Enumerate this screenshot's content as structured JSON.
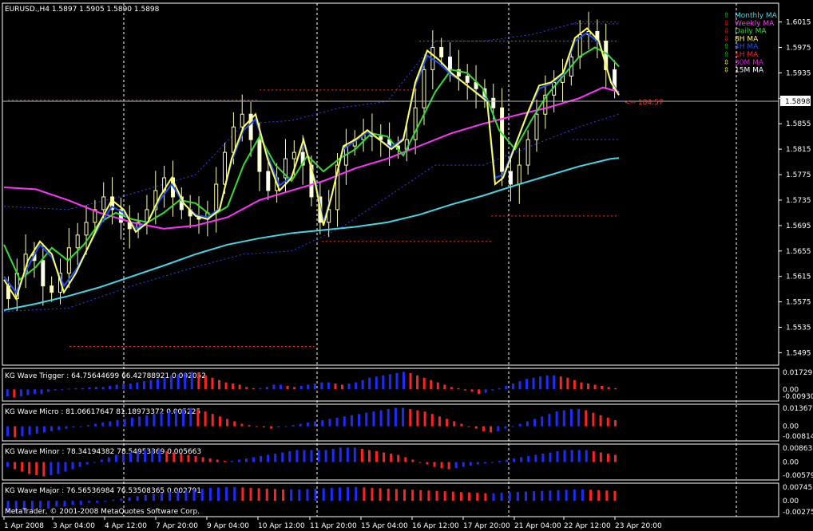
{
  "symbol_header": "EURUSD.,H4  1.5897  1.5905  1.5890  1.5898",
  "current_price": "1.5898",
  "countdown": "<-- 184:57",
  "copyright": "MetaTrader, © 2001-2008 MetaQuotes Software Corp.",
  "legend": [
    {
      "label": "Monthly MA",
      "color": "#44d6e8",
      "arrow": "⇧",
      "arrow_color": "#22cc22"
    },
    {
      "label": "Weekly MA",
      "color": "#ff33ff",
      "arrow": "⇩",
      "arrow_color": "#ff2222"
    },
    {
      "label": "Daily MA",
      "color": "#33dd33",
      "arrow": "⇩",
      "arrow_color": "#ff2222"
    },
    {
      "label": "8H MA",
      "color": "#ffff55",
      "arrow": "⇩",
      "arrow_color": "#ff2222"
    },
    {
      "label": "4H MA",
      "color": "#1e4fff",
      "arrow": "⇧",
      "arrow_color": "#22cc22"
    },
    {
      "label": "1H MA",
      "color": "#ff2222",
      "arrow": "⇧",
      "arrow_color": "#22cc22"
    },
    {
      "label": "30M MA",
      "color": "#cc22cc",
      "arrow": "⇳",
      "arrow_color": "#ffff55"
    },
    {
      "label": "15M MA",
      "color": "#ffffff",
      "arrow": "⇳",
      "arrow_color": "#ffff55"
    }
  ],
  "price_axis": {
    "ticks": [
      "1.6015",
      "1.5975",
      "1.5935",
      "1.5895",
      "1.5855",
      "1.5815",
      "1.5775",
      "1.5735",
      "1.5695",
      "1.5655",
      "1.5615",
      "1.5575",
      "1.5535",
      "1.5495"
    ],
    "ylim": [
      1.5478,
      1.6042
    ]
  },
  "time_axis": [
    "1 Apr 2008",
    "3 Apr 04:00",
    "4 Apr 12:00",
    "7 Apr 20:00",
    "9 Apr 04:00",
    "10 Apr 12:00",
    "11 Apr 20:00",
    "15 Apr 04:00",
    "16 Apr 12:00",
    "17 Apr 20:00",
    "21 Apr 04:00",
    "22 Apr 12:00",
    "23 Apr 20:00"
  ],
  "chart_data": {
    "type": "candlestick",
    "ma_monthly": [
      [
        0,
        1.5562
      ],
      [
        40,
        1.5572
      ],
      [
        80,
        1.5584
      ],
      [
        120,
        1.5598
      ],
      [
        160,
        1.5615
      ],
      [
        200,
        1.5632
      ],
      [
        240,
        1.565
      ],
      [
        280,
        1.5665
      ],
      [
        320,
        1.5675
      ],
      [
        360,
        1.5683
      ],
      [
        400,
        1.5688
      ],
      [
        440,
        1.5693
      ],
      [
        480,
        1.57
      ],
      [
        520,
        1.5712
      ],
      [
        560,
        1.5728
      ],
      [
        600,
        1.5742
      ],
      [
        640,
        1.5758
      ],
      [
        680,
        1.5773
      ],
      [
        720,
        1.5788
      ],
      [
        760,
        1.58
      ],
      [
        770,
        1.5801
      ]
    ],
    "ma_weekly": [
      [
        0,
        1.5755
      ],
      [
        40,
        1.5752
      ],
      [
        80,
        1.5735
      ],
      [
        120,
        1.5715
      ],
      [
        160,
        1.57
      ],
      [
        200,
        1.569
      ],
      [
        240,
        1.5695
      ],
      [
        280,
        1.5708
      ],
      [
        320,
        1.5735
      ],
      [
        360,
        1.575
      ],
      [
        400,
        1.5765
      ],
      [
        440,
        1.5785
      ],
      [
        480,
        1.58
      ],
      [
        520,
        1.582
      ],
      [
        560,
        1.584
      ],
      [
        600,
        1.5855
      ],
      [
        640,
        1.5868
      ],
      [
        680,
        1.588
      ],
      [
        720,
        1.5895
      ],
      [
        750,
        1.5912
      ],
      [
        770,
        1.5905
      ]
    ],
    "ma_daily": [
      [
        0,
        1.5665
      ],
      [
        20,
        1.561
      ],
      [
        40,
        1.563
      ],
      [
        60,
        1.566
      ],
      [
        80,
        1.564
      ],
      [
        100,
        1.5665
      ],
      [
        120,
        1.57
      ],
      [
        140,
        1.5715
      ],
      [
        160,
        1.5705
      ],
      [
        180,
        1.57
      ],
      [
        200,
        1.5715
      ],
      [
        220,
        1.5735
      ],
      [
        240,
        1.573
      ],
      [
        260,
        1.571
      ],
      [
        280,
        1.5725
      ],
      [
        300,
        1.579
      ],
      [
        320,
        1.5835
      ],
      [
        340,
        1.579
      ],
      [
        360,
        1.5765
      ],
      [
        380,
        1.5805
      ],
      [
        400,
        1.578
      ],
      [
        420,
        1.58
      ],
      [
        440,
        1.5815
      ],
      [
        460,
        1.584
      ],
      [
        480,
        1.5835
      ],
      [
        500,
        1.5805
      ],
      [
        520,
        1.5855
      ],
      [
        540,
        1.5905
      ],
      [
        560,
        1.594
      ],
      [
        580,
        1.5935
      ],
      [
        600,
        1.591
      ],
      [
        620,
        1.5845
      ],
      [
        640,
        1.5815
      ],
      [
        660,
        1.586
      ],
      [
        680,
        1.59
      ],
      [
        700,
        1.593
      ],
      [
        720,
        1.596
      ],
      [
        740,
        1.5975
      ],
      [
        755,
        1.5965
      ],
      [
        770,
        1.5945
      ]
    ],
    "ma_8h": [
      [
        0,
        1.561
      ],
      [
        15,
        1.558
      ],
      [
        30,
        1.564
      ],
      [
        45,
        1.567
      ],
      [
        60,
        1.565
      ],
      [
        75,
        1.559
      ],
      [
        90,
        1.562
      ],
      [
        105,
        1.566
      ],
      [
        120,
        1.57
      ],
      [
        135,
        1.5735
      ],
      [
        150,
        1.572
      ],
      [
        165,
        1.5685
      ],
      [
        180,
        1.57
      ],
      [
        195,
        1.574
      ],
      [
        210,
        1.577
      ],
      [
        225,
        1.573
      ],
      [
        240,
        1.571
      ],
      [
        255,
        1.5705
      ],
      [
        270,
        1.572
      ],
      [
        285,
        1.58
      ],
      [
        300,
        1.585
      ],
      [
        315,
        1.587
      ],
      [
        330,
        1.58
      ],
      [
        345,
        1.575
      ],
      [
        360,
        1.577
      ],
      [
        375,
        1.583
      ],
      [
        390,
        1.576
      ],
      [
        400,
        1.5695
      ],
      [
        410,
        1.574
      ],
      [
        425,
        1.582
      ],
      [
        440,
        1.583
      ],
      [
        455,
        1.5845
      ],
      [
        470,
        1.583
      ],
      [
        485,
        1.5815
      ],
      [
        500,
        1.583
      ],
      [
        515,
        1.592
      ],
      [
        530,
        1.597
      ],
      [
        545,
        1.5955
      ],
      [
        560,
        1.5935
      ],
      [
        575,
        1.592
      ],
      [
        590,
        1.5905
      ],
      [
        605,
        1.589
      ],
      [
        615,
        1.576
      ],
      [
        625,
        1.577
      ],
      [
        640,
        1.582
      ],
      [
        655,
        1.587
      ],
      [
        670,
        1.5915
      ],
      [
        685,
        1.592
      ],
      [
        700,
        1.5935
      ],
      [
        715,
        1.599
      ],
      [
        730,
        1.6005
      ],
      [
        745,
        1.5985
      ],
      [
        760,
        1.592
      ],
      [
        770,
        1.59
      ]
    ],
    "ma_4h": [
      [
        0,
        1.5615
      ],
      [
        15,
        1.559
      ],
      [
        30,
        1.563
      ],
      [
        45,
        1.5665
      ],
      [
        60,
        1.5645
      ],
      [
        75,
        1.56
      ],
      [
        90,
        1.5625
      ],
      [
        105,
        1.566
      ],
      [
        120,
        1.5695
      ],
      [
        135,
        1.5725
      ],
      [
        150,
        1.5715
      ],
      [
        165,
        1.569
      ],
      [
        180,
        1.57
      ],
      [
        195,
        1.5735
      ],
      [
        210,
        1.576
      ],
      [
        225,
        1.573
      ],
      [
        240,
        1.5712
      ],
      [
        255,
        1.5708
      ],
      [
        270,
        1.5722
      ],
      [
        285,
        1.5795
      ],
      [
        300,
        1.5845
      ],
      [
        315,
        1.5862
      ],
      [
        330,
        1.5805
      ],
      [
        345,
        1.5758
      ],
      [
        360,
        1.5772
      ],
      [
        375,
        1.5825
      ],
      [
        390,
        1.5765
      ],
      [
        400,
        1.57
      ],
      [
        410,
        1.5742
      ],
      [
        425,
        1.5815
      ],
      [
        440,
        1.5828
      ],
      [
        455,
        1.5842
      ],
      [
        470,
        1.583
      ],
      [
        485,
        1.5818
      ],
      [
        500,
        1.5832
      ],
      [
        515,
        1.5915
      ],
      [
        530,
        1.5962
      ],
      [
        545,
        1.595
      ],
      [
        560,
        1.5932
      ],
      [
        575,
        1.592
      ],
      [
        590,
        1.5906
      ],
      [
        605,
        1.5892
      ],
      [
        615,
        1.577
      ],
      [
        625,
        1.5775
      ],
      [
        640,
        1.5822
      ],
      [
        655,
        1.5868
      ],
      [
        670,
        1.591
      ],
      [
        685,
        1.5918
      ],
      [
        700,
        1.5932
      ],
      [
        715,
        1.5985
      ],
      [
        730,
        1.5998
      ],
      [
        745,
        1.5982
      ],
      [
        760,
        1.5922
      ],
      [
        770,
        1.5902
      ]
    ],
    "bb_upper": [
      [
        0,
        1.5725
      ],
      [
        80,
        1.572
      ],
      [
        160,
        1.5745
      ],
      [
        240,
        1.5775
      ],
      [
        300,
        1.5855
      ],
      [
        360,
        1.586
      ],
      [
        420,
        1.588
      ],
      [
        480,
        1.589
      ],
      [
        540,
        1.5985
      ],
      [
        600,
        1.5985
      ],
      [
        660,
        1.5995
      ],
      [
        720,
        1.6015
      ],
      [
        770,
        1.6015
      ]
    ],
    "bb_lower": [
      [
        0,
        1.556
      ],
      [
        80,
        1.5565
      ],
      [
        160,
        1.56
      ],
      [
        240,
        1.563
      ],
      [
        300,
        1.565
      ],
      [
        360,
        1.5655
      ],
      [
        420,
        1.569
      ],
      [
        480,
        1.574
      ],
      [
        540,
        1.579
      ],
      [
        600,
        1.579
      ],
      [
        660,
        1.582
      ],
      [
        720,
        1.585
      ],
      [
        770,
        1.587
      ]
    ],
    "levels": [
      {
        "price": 1.5892,
        "x0": 5,
        "x1": 320,
        "color": "#ff2222"
      },
      {
        "price": 1.5908,
        "x0": 320,
        "x1": 520,
        "color": "#ff2222"
      },
      {
        "price": 1.5985,
        "x0": 520,
        "x1": 770,
        "color": "#ff2222"
      },
      {
        "price": 1.5505,
        "x0": 82,
        "x1": 388,
        "color": "#ff2222"
      },
      {
        "price": 1.567,
        "x0": 398,
        "x1": 610,
        "color": "#ff2222"
      },
      {
        "price": 1.571,
        "x0": 610,
        "x1": 770,
        "color": "#ff2222"
      },
      {
        "price": 1.6012,
        "x0": 712,
        "x1": 770,
        "color": "#2244ff"
      },
      {
        "price": 1.583,
        "x0": 712,
        "x1": 770,
        "color": "#2244ff"
      }
    ],
    "candle_seed": [
      1.56,
      1.558,
      1.562,
      1.565,
      1.564,
      1.56,
      1.559,
      1.562,
      1.566,
      1.568,
      1.57,
      1.572,
      1.574,
      1.572,
      1.57,
      1.569,
      1.57,
      1.572,
      1.575,
      1.577,
      1.574,
      1.572,
      1.571,
      1.5705,
      1.5715,
      1.576,
      1.581,
      1.585,
      1.587,
      1.583,
      1.578,
      1.575,
      1.577,
      1.58,
      1.581,
      1.579,
      1.574,
      1.57,
      1.572,
      1.579,
      1.582,
      1.583,
      1.584,
      1.5835,
      1.583,
      1.582,
      1.5815,
      1.583,
      1.588,
      1.594,
      1.5975,
      1.596,
      1.594,
      1.593,
      1.592,
      1.591,
      1.5895,
      1.588,
      1.578,
      1.576,
      1.579,
      1.583,
      1.587,
      1.59,
      1.592,
      1.593,
      1.596,
      1.5995,
      1.6,
      1.5985,
      1.594,
      1.591
    ]
  },
  "indicators": [
    {
      "label": "KG Wave Trigger : 64.75644699 66.42788921 0.002052",
      "ticks": [
        "0.017297",
        "0.00",
        "-0.009301"
      ],
      "values": [
        -3,
        -3.5,
        -3,
        -2.5,
        -2,
        -2,
        -1,
        -0.5,
        0,
        0.3,
        0.5,
        0.5,
        0.8,
        1,
        1,
        1.5,
        2,
        2.5,
        2.5,
        3,
        3.5,
        4,
        4.5,
        5,
        6,
        6.5,
        7,
        7.5,
        7,
        6,
        5,
        4,
        3,
        2.5,
        2,
        1,
        0.5,
        0.5,
        1,
        2,
        2,
        1.5,
        1,
        1.5,
        2,
        2.5,
        3,
        3,
        2.5,
        2,
        2.5,
        3,
        4,
        5,
        5.5,
        6,
        6.5,
        7,
        7.5,
        7,
        6,
        5,
        4,
        3,
        2,
        1,
        0.5,
        -0.5,
        -1,
        -2,
        -1.5,
        -0.5,
        0.5,
        1.5,
        2.5,
        3.5,
        4.5,
        5,
        5.5,
        6,
        6,
        5.5,
        5,
        4,
        3,
        2.5,
        2,
        1.5,
        1,
        0.5
      ],
      "vmin": -4,
      "vmax": 8
    },
    {
      "label": "KG Wave Micro : 81.06617647 81.18973372 0.005225",
      "ticks": [
        "0.013679",
        "0.00",
        "-0.008147"
      ],
      "values": [
        -4,
        -4.5,
        -4,
        -3.5,
        -3,
        -2.5,
        -2,
        -1.5,
        -1,
        -0.5,
        0,
        0.5,
        1,
        1.5,
        2,
        2.5,
        3,
        3.5,
        4,
        4.5,
        5,
        5.5,
        6,
        6.5,
        7,
        7.5,
        7,
        6,
        5,
        4,
        3,
        2,
        1,
        0.5,
        0,
        -0.5,
        -1,
        -0.5,
        0,
        0.5,
        1,
        1.5,
        2,
        2.5,
        3,
        3.5,
        4,
        4.5,
        5,
        5.5,
        6,
        6.5,
        7,
        7.5,
        7.5,
        7,
        6.5,
        6,
        5,
        4,
        3,
        2,
        1,
        0,
        -1,
        -2,
        -2.5,
        -2,
        -1,
        0,
        1,
        2,
        3,
        4,
        5,
        6,
        6.5,
        7,
        7,
        6.5,
        5.5,
        4.5,
        3.5,
        2.5
      ],
      "vmin": -5,
      "vmax": 8
    },
    {
      "label": "KG Wave Minor : 78.34194382 78.54953369 0.005663",
      "ticks": [
        "0.008633",
        "0.00",
        "-0.005795"
      ],
      "values": [
        -2,
        -3,
        -4,
        -5,
        -5.5,
        -6,
        -5.5,
        -5,
        -4,
        -3,
        -2,
        -1,
        0,
        1,
        2,
        3,
        3.5,
        4,
        4.5,
        5,
        5,
        5,
        4.5,
        4,
        3.5,
        3,
        2.5,
        2,
        1.5,
        1,
        0.5,
        0.5,
        1,
        1.5,
        2,
        2.5,
        3,
        3.5,
        4,
        4.5,
        5,
        5,
        5,
        5,
        5,
        5.5,
        6,
        6,
        6,
        5.5,
        5,
        4.5,
        4,
        3.5,
        3,
        2,
        1,
        0,
        -1,
        -2,
        -2.5,
        -3,
        -2.5,
        -2,
        -1.5,
        -1,
        -0.5,
        0,
        0.5,
        1,
        1.5,
        2,
        2.5,
        3,
        3.5,
        4,
        4.5,
        5,
        5,
        5,
        5,
        4.5,
        4,
        3.5,
        3
      ],
      "vmin": -6.5,
      "vmax": 6.5
    },
    {
      "label": "KG Wave Major : 76.56536984 76.53508365 0.002791",
      "ticks": [
        "0.007457",
        "0.00",
        "-0.002759"
      ],
      "values": [
        -3,
        -3,
        -2.5,
        -2.5,
        -2,
        -2,
        -1.5,
        -1.5,
        -1,
        -1,
        -0.5,
        -0.5,
        0,
        0.3,
        0.6,
        0.9,
        1.2,
        1.5,
        1.8,
        2.1,
        2.4,
        2.6,
        2.8,
        3,
        3.2,
        3.4,
        3.5,
        3.6,
        3.6,
        3.5,
        3.4,
        3.3,
        3.2,
        3.1,
        3,
        3,
        3,
        3.1,
        3.2,
        3.3,
        3.4,
        3.5,
        3.6,
        3.6,
        3.5,
        3.4,
        3.3,
        3.2,
        3.1,
        3,
        2.9,
        2.8,
        2.7,
        2.6,
        2.5,
        2.4,
        2.3,
        2.2,
        2.1,
        2,
        2,
        2.1,
        2.2,
        2.3,
        2.4,
        2.5,
        2.6,
        2.7,
        2.8,
        2.9,
        3,
        3,
        2.9,
        2.8,
        2.7,
        2.6
      ],
      "vmin": -3.5,
      "vmax": 4
    }
  ]
}
